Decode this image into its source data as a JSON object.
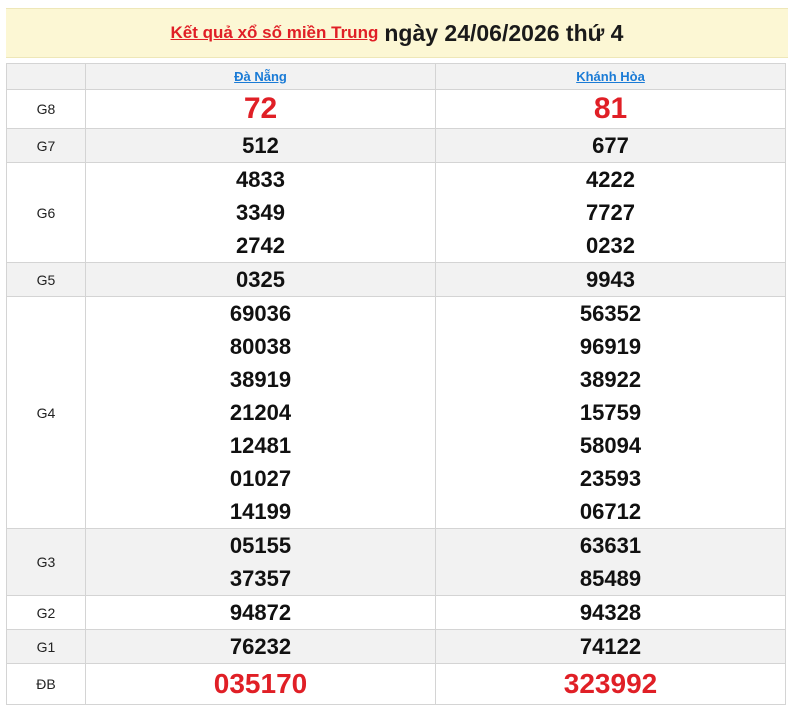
{
  "header": {
    "link_text": "Kết quả xổ số miền Trung",
    "date_text": "ngày 24/06/2026 thứ 4"
  },
  "provinces": [
    "Đà Nẵng",
    "Khánh Hòa"
  ],
  "results": [
    {
      "prize": "G8",
      "da_nang": [
        "72"
      ],
      "khanh_hoa": [
        "81"
      ]
    },
    {
      "prize": "G7",
      "da_nang": [
        "512"
      ],
      "khanh_hoa": [
        "677"
      ]
    },
    {
      "prize": "G6",
      "da_nang": [
        "4833",
        "3349",
        "2742"
      ],
      "khanh_hoa": [
        "4222",
        "7727",
        "0232"
      ]
    },
    {
      "prize": "G5",
      "da_nang": [
        "0325"
      ],
      "khanh_hoa": [
        "9943"
      ]
    },
    {
      "prize": "G4",
      "da_nang": [
        "69036",
        "80038",
        "38919",
        "21204",
        "12481",
        "01027",
        "14199"
      ],
      "khanh_hoa": [
        "56352",
        "96919",
        "38922",
        "15759",
        "58094",
        "23593",
        "06712"
      ]
    },
    {
      "prize": "G3",
      "da_nang": [
        "05155",
        "37357"
      ],
      "khanh_hoa": [
        "63631",
        "85489"
      ]
    },
    {
      "prize": "G2",
      "da_nang": [
        "94872"
      ],
      "khanh_hoa": [
        "94328"
      ]
    },
    {
      "prize": "G1",
      "da_nang": [
        "76232"
      ],
      "khanh_hoa": [
        "74122"
      ]
    },
    {
      "prize": "ĐB",
      "da_nang": [
        "035170"
      ],
      "khanh_hoa": [
        "323992"
      ]
    }
  ],
  "colors": {
    "accent_red": "#e01f26",
    "link_blue": "#1a7bd6",
    "title_bg": "#fcf7d4"
  }
}
